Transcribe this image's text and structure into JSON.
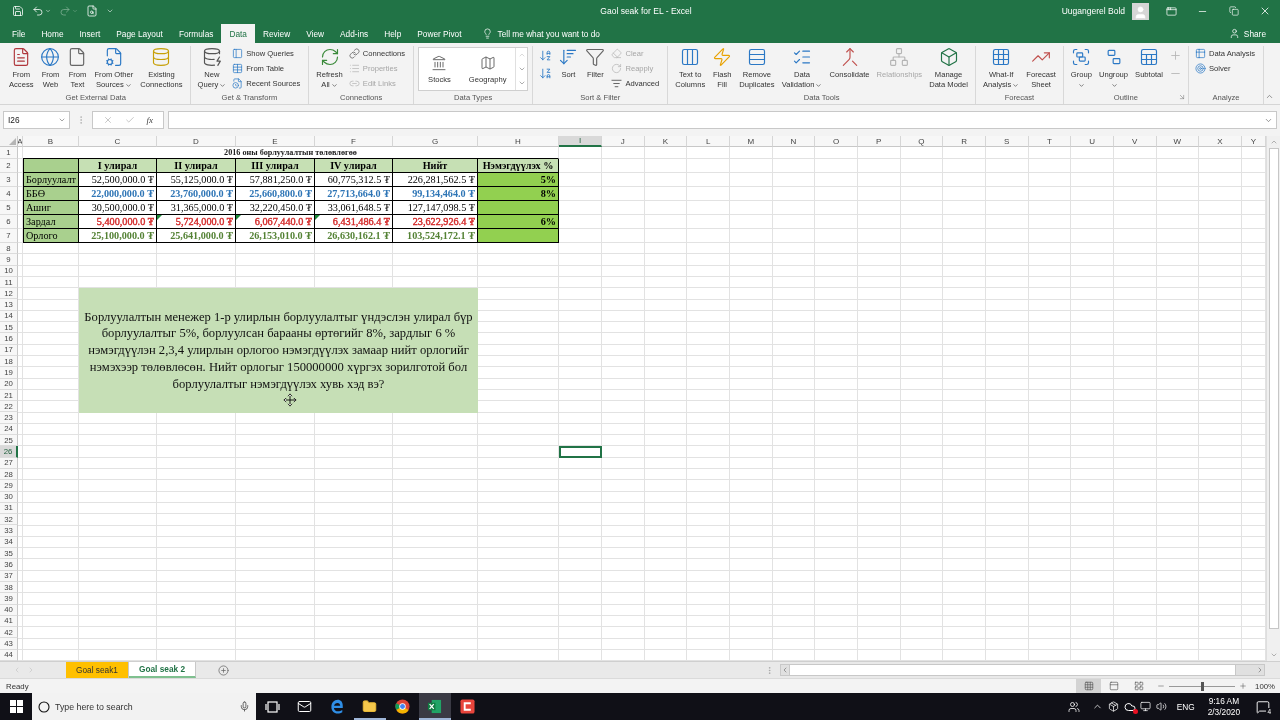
{
  "title_bar": {
    "title": "Gaol seak for EL - Excel",
    "user": "Uugangerel Bold"
  },
  "quick_access": [
    {
      "disabled": false,
      "dropdown": false
    },
    {
      "disabled": false,
      "dropdown": true
    },
    {
      "disabled": true,
      "dropdown": true
    },
    {
      "disabled": false,
      "dropdown": false
    }
  ],
  "tabs": [
    {
      "label": "File",
      "selected": false
    },
    {
      "label": "Home",
      "selected": false
    },
    {
      "label": "Insert",
      "selected": false
    },
    {
      "label": "Page Layout",
      "selected": false
    },
    {
      "label": "Formulas",
      "selected": false
    },
    {
      "label": "Data",
      "selected": true
    },
    {
      "label": "Review",
      "selected": false
    },
    {
      "label": "View",
      "selected": false
    },
    {
      "label": "Add-ins",
      "selected": false
    },
    {
      "label": "Help",
      "selected": false
    },
    {
      "label": "Power Pivot",
      "selected": false
    }
  ],
  "tell_me": "Tell me what you want to do",
  "share": "Share",
  "ribbon": {
    "groups": [
      {
        "label": "Get External Data",
        "launcher": false,
        "commands": [
          {
            "kind": "large",
            "lines": [
              "From",
              "Access"
            ],
            "dropdown": false,
            "disabled": false
          },
          {
            "kind": "large",
            "lines": [
              "From",
              "Web"
            ],
            "dropdown": false,
            "disabled": false
          },
          {
            "kind": "large",
            "lines": [
              "From",
              "Text"
            ],
            "dropdown": false,
            "disabled": false
          },
          {
            "kind": "large",
            "lines": [
              "From Other",
              "Sources"
            ],
            "dropdown": true,
            "disabled": false
          },
          {
            "kind": "large",
            "lines": [
              "Existing",
              "Connections"
            ],
            "dropdown": false,
            "disabled": false
          }
        ]
      },
      {
        "label": "Get & Transform",
        "launcher": false,
        "commands": [
          {
            "kind": "large",
            "lines": [
              "New",
              "Query"
            ],
            "dropdown": true,
            "disabled": false
          },
          {
            "kind": "small",
            "lines": [
              "Show Queries"
            ],
            "dropdown": false,
            "disabled": false
          },
          {
            "kind": "small",
            "lines": [
              "From Table"
            ],
            "dropdown": false,
            "disabled": false
          },
          {
            "kind": "small",
            "lines": [
              "Recent Sources"
            ],
            "dropdown": false,
            "disabled": false
          }
        ]
      },
      {
        "label": "Connections",
        "launcher": false,
        "commands": [
          {
            "kind": "large",
            "lines": [
              "Refresh",
              "All"
            ],
            "dropdown": true,
            "disabled": false
          },
          {
            "kind": "small",
            "lines": [
              "Connections"
            ],
            "dropdown": false,
            "disabled": false
          },
          {
            "kind": "small",
            "lines": [
              "Properties"
            ],
            "dropdown": false,
            "disabled": true
          },
          {
            "kind": "small",
            "lines": [
              "Edit Links"
            ],
            "dropdown": false,
            "disabled": true
          }
        ]
      },
      {
        "label": "Data Types",
        "launcher": false,
        "commands": [
          {
            "kind": "gallery",
            "lines": [
              "Stocks"
            ],
            "dropdown": false,
            "disabled": false
          },
          {
            "kind": "gallery",
            "lines": [
              "Geography"
            ],
            "dropdown": false,
            "disabled": false
          }
        ]
      },
      {
        "label": "Sort & Filter",
        "launcher": false,
        "commands": [
          {
            "kind": "icon",
            "dropdown": false,
            "disabled": false
          },
          {
            "kind": "icon",
            "dropdown": false,
            "disabled": false
          },
          {
            "kind": "large",
            "lines": [
              "Sort"
            ],
            "dropdown": false,
            "disabled": false
          },
          {
            "kind": "large",
            "lines": [
              "Filter"
            ],
            "dropdown": false,
            "disabled": false
          },
          {
            "kind": "small",
            "lines": [
              "Clear"
            ],
            "dropdown": false,
            "disabled": true
          },
          {
            "kind": "small",
            "lines": [
              "Reapply"
            ],
            "dropdown": false,
            "disabled": true
          },
          {
            "kind": "small",
            "lines": [
              "Advanced"
            ],
            "dropdown": false,
            "disabled": false
          }
        ]
      },
      {
        "label": "Data Tools",
        "launcher": false,
        "commands": [
          {
            "kind": "large",
            "lines": [
              "Text to",
              "Columns"
            ],
            "dropdown": false,
            "disabled": false
          },
          {
            "kind": "large",
            "lines": [
              "Flash",
              "Fill"
            ],
            "dropdown": false,
            "disabled": false
          },
          {
            "kind": "large",
            "lines": [
              "Remove",
              "Duplicates"
            ],
            "dropdown": false,
            "disabled": false
          },
          {
            "kind": "large",
            "lines": [
              "Data",
              "Validation"
            ],
            "dropdown": true,
            "disabled": false
          },
          {
            "kind": "large",
            "lines": [
              "Consolidate"
            ],
            "dropdown": false,
            "disabled": false
          },
          {
            "kind": "large",
            "lines": [
              "Relationships"
            ],
            "dropdown": false,
            "disabled": true
          },
          {
            "kind": "large",
            "lines": [
              "Manage",
              "Data Model"
            ],
            "dropdown": false,
            "disabled": false
          }
        ]
      },
      {
        "label": "Forecast",
        "launcher": false,
        "commands": [
          {
            "kind": "large",
            "lines": [
              "What-If",
              "Analysis"
            ],
            "dropdown": true,
            "disabled": false
          },
          {
            "kind": "large",
            "lines": [
              "Forecast",
              "Sheet"
            ],
            "dropdown": false,
            "disabled": false
          }
        ]
      },
      {
        "label": "Outline",
        "launcher": true,
        "commands": [
          {
            "kind": "large",
            "lines": [
              "Group"
            ],
            "dropdown": true,
            "disabled": false
          },
          {
            "kind": "large",
            "lines": [
              "Ungroup"
            ],
            "dropdown": true,
            "disabled": false
          },
          {
            "kind": "large",
            "lines": [
              "Subtotal"
            ],
            "dropdown": false,
            "disabled": false
          },
          {
            "kind": "icon",
            "dropdown": false,
            "disabled": true
          },
          {
            "kind": "icon",
            "dropdown": false,
            "disabled": true
          }
        ]
      },
      {
        "label": "Analyze",
        "launcher": false,
        "commands": [
          {
            "kind": "small",
            "lines": [
              "Data Analysis"
            ],
            "dropdown": false,
            "disabled": false
          },
          {
            "kind": "small",
            "lines": [
              "Solver"
            ],
            "dropdown": false,
            "disabled": false
          }
        ]
      }
    ]
  },
  "formula_bar": {
    "name_box": "I26",
    "function_label": "fx"
  },
  "sheet": {
    "columns": [
      {
        "label": "A",
        "selected": false
      },
      {
        "label": "B",
        "selected": false
      },
      {
        "label": "C",
        "selected": false
      },
      {
        "label": "D",
        "selected": false
      },
      {
        "label": "E",
        "selected": false
      },
      {
        "label": "F",
        "selected": false
      },
      {
        "label": "G",
        "selected": false
      },
      {
        "label": "H",
        "selected": false
      },
      {
        "label": "I",
        "selected": true
      },
      {
        "label": "J",
        "selected": false
      },
      {
        "label": "K",
        "selected": false
      },
      {
        "label": "L",
        "selected": false
      },
      {
        "label": "M",
        "selected": false
      },
      {
        "label": "N",
        "selected": false
      },
      {
        "label": "O",
        "selected": false
      },
      {
        "label": "P",
        "selected": false
      },
      {
        "label": "Q",
        "selected": false
      },
      {
        "label": "R",
        "selected": false
      },
      {
        "label": "S",
        "selected": false
      },
      {
        "label": "T",
        "selected": false
      },
      {
        "label": "U",
        "selected": false
      },
      {
        "label": "V",
        "selected": false
      },
      {
        "label": "W",
        "selected": false
      },
      {
        "label": "X",
        "selected": false
      },
      {
        "label": "Y",
        "selected": false
      }
    ],
    "rows": [
      {
        "label": "1",
        "selected": false
      },
      {
        "label": "2",
        "selected": false
      },
      {
        "label": "3",
        "selected": false
      },
      {
        "label": "4",
        "selected": false
      },
      {
        "label": "5",
        "selected": false
      },
      {
        "label": "6",
        "selected": false
      },
      {
        "label": "7",
        "selected": false
      },
      {
        "label": "8",
        "selected": false
      },
      {
        "label": "9",
        "selected": false
      },
      {
        "label": "10",
        "selected": false
      },
      {
        "label": "11",
        "selected": false
      },
      {
        "label": "12",
        "selected": false
      },
      {
        "label": "13",
        "selected": false
      },
      {
        "label": "14",
        "selected": false
      },
      {
        "label": "15",
        "selected": false
      },
      {
        "label": "16",
        "selected": false
      },
      {
        "label": "17",
        "selected": false
      },
      {
        "label": "18",
        "selected": false
      },
      {
        "label": "19",
        "selected": false
      },
      {
        "label": "20",
        "selected": false
      },
      {
        "label": "21",
        "selected": false
      },
      {
        "label": "22",
        "selected": false
      },
      {
        "label": "23",
        "selected": false
      },
      {
        "label": "24",
        "selected": false
      },
      {
        "label": "25",
        "selected": false
      },
      {
        "label": "26",
        "selected": true
      },
      {
        "label": "27",
        "selected": false
      },
      {
        "label": "28",
        "selected": false
      },
      {
        "label": "29",
        "selected": false
      },
      {
        "label": "30",
        "selected": false
      },
      {
        "label": "31",
        "selected": false
      },
      {
        "label": "32",
        "selected": false
      },
      {
        "label": "33",
        "selected": false
      },
      {
        "label": "34",
        "selected": false
      },
      {
        "label": "35",
        "selected": false
      },
      {
        "label": "36",
        "selected": false
      },
      {
        "label": "37",
        "selected": false
      },
      {
        "label": "38",
        "selected": false
      },
      {
        "label": "39",
        "selected": false
      },
      {
        "label": "40",
        "selected": false
      },
      {
        "label": "41",
        "selected": false
      },
      {
        "label": "42",
        "selected": false
      },
      {
        "label": "43",
        "selected": false
      },
      {
        "label": "44",
        "selected": false
      }
    ],
    "title": "2016 оны борлуулалтын төлөвлөгөө",
    "table": {
      "header": [
        "I улирал",
        "II улирал",
        "III улирал",
        "IV улирал",
        "Нийт",
        "Нэмэгдүүлэх %"
      ],
      "rows": [
        {
          "label": "Борлуулалт",
          "color": "#000000",
          "bold": false,
          "cells": [
            {
              "text": "52,500,000.0 ₮",
              "flagged": false
            },
            {
              "text": "55,125,000.0 ₮",
              "flagged": false
            },
            {
              "text": "57,881,250.0 ₮",
              "flagged": false
            },
            {
              "text": "60,775,312.5 ₮",
              "flagged": false
            },
            {
              "text": "226,281,562.5 ₮",
              "flagged": false
            }
          ],
          "increase": "5%"
        },
        {
          "label": "ББӨ",
          "color": "#2e75b6",
          "bold": true,
          "cells": [
            {
              "text": "22,000,000.0 ₮",
              "flagged": false
            },
            {
              "text": "23,760,000.0 ₮",
              "flagged": false
            },
            {
              "text": "25,660,800.0 ₮",
              "flagged": false
            },
            {
              "text": "27,713,664.0 ₮",
              "flagged": false
            },
            {
              "text": "99,134,464.0 ₮",
              "flagged": false
            }
          ],
          "increase": "8%"
        },
        {
          "label": "Ашиг",
          "color": "#000000",
          "bold": false,
          "cells": [
            {
              "text": "30,500,000.0 ₮",
              "flagged": false
            },
            {
              "text": "31,365,000.0 ₮",
              "flagged": false
            },
            {
              "text": "32,220,450.0 ₮",
              "flagged": false
            },
            {
              "text": "33,061,648.5 ₮",
              "flagged": false
            },
            {
              "text": "127,147,098.5 ₮",
              "flagged": false
            }
          ]
        },
        {
          "label": "Зардал",
          "color": "#d42a2a",
          "bold": false,
          "cells": [
            {
              "text": "5,400,000.0 ₮",
              "flagged": false
            },
            {
              "text": "5,724,000.0 ₮",
              "flagged": true
            },
            {
              "text": "6,067,440.0 ₮",
              "flagged": true
            },
            {
              "text": "6,431,486.4 ₮",
              "flagged": true
            },
            {
              "text": "23,622,926.4 ₮",
              "flagged": false
            }
          ],
          "increase": "6%"
        },
        {
          "label": "Орлого",
          "color": "#548235",
          "bold": true,
          "cells": [
            {
              "text": "25,100,000.0 ₮",
              "flagged": false
            },
            {
              "text": "25,641,000.0 ₮",
              "flagged": false
            },
            {
              "text": "26,153,010.0 ₮",
              "flagged": false
            },
            {
              "text": "26,630,162.1 ₮",
              "flagged": false
            },
            {
              "text": "103,524,172.1 ₮",
              "flagged": false
            }
          ]
        }
      ]
    },
    "note": "Борлуулалтын менежер 1-р улирлын борлуулалтыг үндэслэн улирал бүр борлуулалтыг 5%, борлуулсан барааны өртөгийг 8%, зардлыг 6 % нэмэгдүүлэн 2,3,4 улирлын орлогоо нэмэгдүүлэх замаар нийт орлогийг нэмэхээр төлөвлөсөн. Нийт орлогыг 150000000 хүргэх зорилготой бол борлуулалтыг нэмэгдүүлэх хувь хэд вэ?"
  },
  "sheet_tabs": [
    {
      "label": "Goal seak1",
      "selected": false,
      "color": "#ffc000"
    },
    {
      "label": "Goal seak 2",
      "selected": true
    }
  ],
  "status_bar": {
    "status": "Ready",
    "view_buttons": [
      {
        "selected": true
      },
      {
        "selected": false
      },
      {
        "selected": false
      }
    ],
    "zoom": {
      "level": 0.5,
      "reading": "100%"
    }
  },
  "taskbar": {
    "search": {
      "placeholder": "Type here to search"
    },
    "apps": [
      {
        "open": false,
        "selected": false
      },
      {
        "open": false,
        "selected": false
      },
      {
        "open": false,
        "selected": false
      },
      {
        "open": true,
        "selected": false
      },
      {
        "open": false,
        "selected": false
      },
      {
        "open": true,
        "selected": true
      },
      {
        "open": false,
        "selected": false
      }
    ],
    "tray": {
      "language": "ENG",
      "time": "9:16 AM",
      "date": "2/3/2020",
      "notifications": "4"
    }
  }
}
